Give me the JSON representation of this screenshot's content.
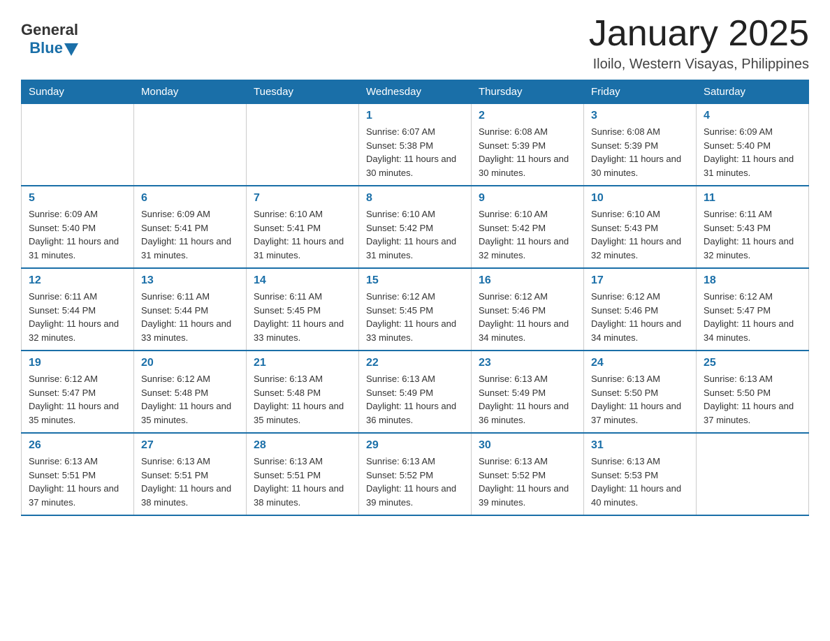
{
  "header": {
    "logo_general": "General",
    "logo_blue": "Blue",
    "month_title": "January 2025",
    "location": "Iloilo, Western Visayas, Philippines"
  },
  "weekdays": [
    "Sunday",
    "Monday",
    "Tuesday",
    "Wednesday",
    "Thursday",
    "Friday",
    "Saturday"
  ],
  "weeks": [
    [
      {
        "day": "",
        "info": ""
      },
      {
        "day": "",
        "info": ""
      },
      {
        "day": "",
        "info": ""
      },
      {
        "day": "1",
        "info": "Sunrise: 6:07 AM\nSunset: 5:38 PM\nDaylight: 11 hours and 30 minutes."
      },
      {
        "day": "2",
        "info": "Sunrise: 6:08 AM\nSunset: 5:39 PM\nDaylight: 11 hours and 30 minutes."
      },
      {
        "day": "3",
        "info": "Sunrise: 6:08 AM\nSunset: 5:39 PM\nDaylight: 11 hours and 30 minutes."
      },
      {
        "day": "4",
        "info": "Sunrise: 6:09 AM\nSunset: 5:40 PM\nDaylight: 11 hours and 31 minutes."
      }
    ],
    [
      {
        "day": "5",
        "info": "Sunrise: 6:09 AM\nSunset: 5:40 PM\nDaylight: 11 hours and 31 minutes."
      },
      {
        "day": "6",
        "info": "Sunrise: 6:09 AM\nSunset: 5:41 PM\nDaylight: 11 hours and 31 minutes."
      },
      {
        "day": "7",
        "info": "Sunrise: 6:10 AM\nSunset: 5:41 PM\nDaylight: 11 hours and 31 minutes."
      },
      {
        "day": "8",
        "info": "Sunrise: 6:10 AM\nSunset: 5:42 PM\nDaylight: 11 hours and 31 minutes."
      },
      {
        "day": "9",
        "info": "Sunrise: 6:10 AM\nSunset: 5:42 PM\nDaylight: 11 hours and 32 minutes."
      },
      {
        "day": "10",
        "info": "Sunrise: 6:10 AM\nSunset: 5:43 PM\nDaylight: 11 hours and 32 minutes."
      },
      {
        "day": "11",
        "info": "Sunrise: 6:11 AM\nSunset: 5:43 PM\nDaylight: 11 hours and 32 minutes."
      }
    ],
    [
      {
        "day": "12",
        "info": "Sunrise: 6:11 AM\nSunset: 5:44 PM\nDaylight: 11 hours and 32 minutes."
      },
      {
        "day": "13",
        "info": "Sunrise: 6:11 AM\nSunset: 5:44 PM\nDaylight: 11 hours and 33 minutes."
      },
      {
        "day": "14",
        "info": "Sunrise: 6:11 AM\nSunset: 5:45 PM\nDaylight: 11 hours and 33 minutes."
      },
      {
        "day": "15",
        "info": "Sunrise: 6:12 AM\nSunset: 5:45 PM\nDaylight: 11 hours and 33 minutes."
      },
      {
        "day": "16",
        "info": "Sunrise: 6:12 AM\nSunset: 5:46 PM\nDaylight: 11 hours and 34 minutes."
      },
      {
        "day": "17",
        "info": "Sunrise: 6:12 AM\nSunset: 5:46 PM\nDaylight: 11 hours and 34 minutes."
      },
      {
        "day": "18",
        "info": "Sunrise: 6:12 AM\nSunset: 5:47 PM\nDaylight: 11 hours and 34 minutes."
      }
    ],
    [
      {
        "day": "19",
        "info": "Sunrise: 6:12 AM\nSunset: 5:47 PM\nDaylight: 11 hours and 35 minutes."
      },
      {
        "day": "20",
        "info": "Sunrise: 6:12 AM\nSunset: 5:48 PM\nDaylight: 11 hours and 35 minutes."
      },
      {
        "day": "21",
        "info": "Sunrise: 6:13 AM\nSunset: 5:48 PM\nDaylight: 11 hours and 35 minutes."
      },
      {
        "day": "22",
        "info": "Sunrise: 6:13 AM\nSunset: 5:49 PM\nDaylight: 11 hours and 36 minutes."
      },
      {
        "day": "23",
        "info": "Sunrise: 6:13 AM\nSunset: 5:49 PM\nDaylight: 11 hours and 36 minutes."
      },
      {
        "day": "24",
        "info": "Sunrise: 6:13 AM\nSunset: 5:50 PM\nDaylight: 11 hours and 37 minutes."
      },
      {
        "day": "25",
        "info": "Sunrise: 6:13 AM\nSunset: 5:50 PM\nDaylight: 11 hours and 37 minutes."
      }
    ],
    [
      {
        "day": "26",
        "info": "Sunrise: 6:13 AM\nSunset: 5:51 PM\nDaylight: 11 hours and 37 minutes."
      },
      {
        "day": "27",
        "info": "Sunrise: 6:13 AM\nSunset: 5:51 PM\nDaylight: 11 hours and 38 minutes."
      },
      {
        "day": "28",
        "info": "Sunrise: 6:13 AM\nSunset: 5:51 PM\nDaylight: 11 hours and 38 minutes."
      },
      {
        "day": "29",
        "info": "Sunrise: 6:13 AM\nSunset: 5:52 PM\nDaylight: 11 hours and 39 minutes."
      },
      {
        "day": "30",
        "info": "Sunrise: 6:13 AM\nSunset: 5:52 PM\nDaylight: 11 hours and 39 minutes."
      },
      {
        "day": "31",
        "info": "Sunrise: 6:13 AM\nSunset: 5:53 PM\nDaylight: 11 hours and 40 minutes."
      },
      {
        "day": "",
        "info": ""
      }
    ]
  ]
}
